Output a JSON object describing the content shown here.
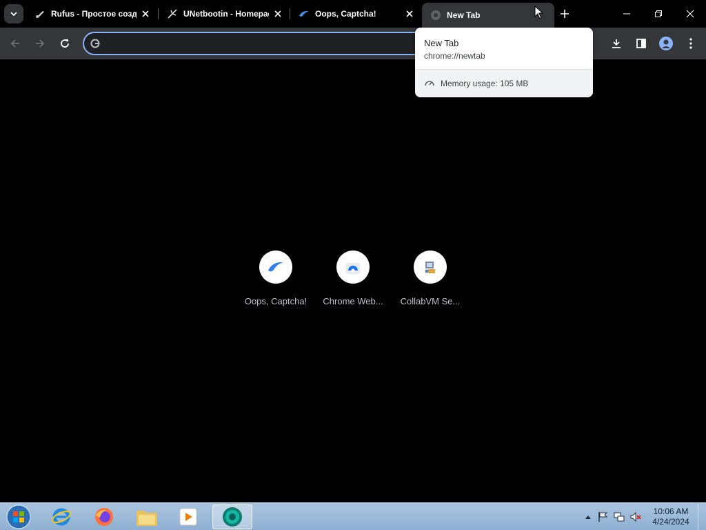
{
  "browser": {
    "tabs": [
      {
        "title": "Rufus - Простое создание загрузочных USB-дисков",
        "icon": "rufus-icon",
        "active": false
      },
      {
        "title": "UNetbootin - Homepage and Downloads",
        "icon": "unetbootin-icon",
        "active": false
      },
      {
        "title": "Oops, Captcha!",
        "icon": "captcha-swirl-icon",
        "active": false
      },
      {
        "title": "New Tab",
        "icon": "globe-icon",
        "active": true
      }
    ],
    "omnibox": {
      "value": "",
      "placeholder": ""
    }
  },
  "hovercard": {
    "title": "New Tab",
    "url": "chrome://newtab",
    "memory": "Memory usage: 105 MB"
  },
  "shortcuts": [
    {
      "label": "Oops, Captcha!",
      "icon": "captcha-swirl-icon"
    },
    {
      "label": "Chrome Web...",
      "icon": "chrome-web-store-icon"
    },
    {
      "label": "CollabVM Se...",
      "icon": "collabvm-icon"
    }
  ],
  "taskbar": {
    "apps": [
      "start-orb",
      "internet-explorer",
      "firefox",
      "file-explorer",
      "media-player",
      "chrome-dev"
    ],
    "clock": {
      "time": "10:06 AM",
      "date": "4/24/2024"
    }
  },
  "colors": {
    "accent": "#8ab4f8",
    "toolbar": "#35363a",
    "content_bg": "#000000"
  }
}
